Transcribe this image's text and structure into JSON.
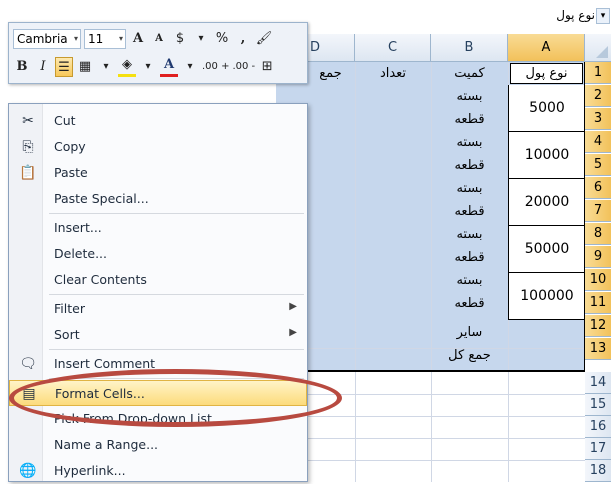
{
  "namebox": {
    "value": "نوع پول",
    "arrow": "▾"
  },
  "columns": [
    {
      "id": "A",
      "selected": true
    },
    {
      "id": "B",
      "selected": false
    },
    {
      "id": "C",
      "selected": false
    },
    {
      "id": "D",
      "selected": false
    }
  ],
  "rows": [
    "1",
    "2",
    "3",
    "4",
    "5",
    "6",
    "7",
    "8",
    "9",
    "10",
    "11",
    "12",
    "13",
    "14",
    "15",
    "16",
    "17",
    "18"
  ],
  "table": {
    "header": {
      "a": "نوع پول",
      "b": "کمیت",
      "c": "تعداد",
      "d": "جمع"
    },
    "b_cells": [
      "بسته",
      "قطعه",
      "بسته",
      "قطعه",
      "بسته",
      "قطعه",
      "بسته",
      "قطعه",
      "بسته",
      "قطعه"
    ],
    "amounts": [
      "5000",
      "10000",
      "20000",
      "50000",
      "100000"
    ],
    "other": "سایر",
    "total": "جمع کل"
  },
  "minitoolbar": {
    "font": "Cambria",
    "size": "11",
    "grow": "A",
    "shrink": "A",
    "currency": "$",
    "percent": "%",
    "comma": ",",
    "bold": "B",
    "italic": "I",
    "font_color": "A",
    "inc_decimal": ".00 +",
    "dec_decimal": ".00 -"
  },
  "menu": {
    "cut": "Cut",
    "copy": "Copy",
    "paste": "Paste",
    "paste_special": "Paste Special...",
    "insert": "Insert...",
    "delete": "Delete...",
    "clear_contents": "Clear Contents",
    "filter": "Filter",
    "sort": "Sort",
    "insert_comment": "Insert Comment",
    "format_cells": "Format Cells...",
    "pick_list": "Pick From Drop-down List...",
    "name_range": "Name a Range...",
    "hyperlink": "Hyperlink..."
  },
  "colors": {
    "selection": "#c6d7ed",
    "highlight_ellipse": "#b84a40",
    "menu_hover": "#fcdb7c"
  }
}
